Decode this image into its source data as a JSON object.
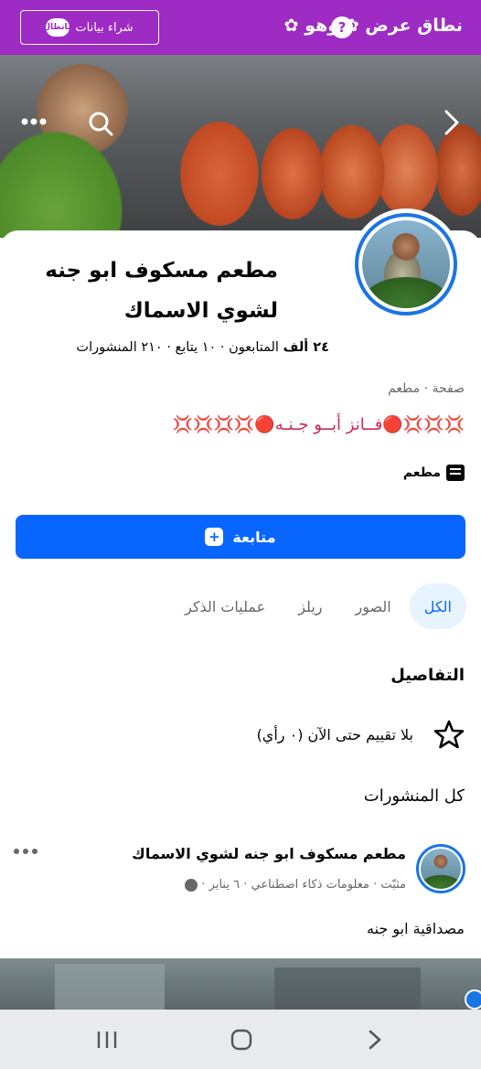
{
  "topbar": {
    "brand": "نطاق عرض ✿ وهو ✿",
    "help_glyph": "?",
    "buy_label": "شراء بيانات",
    "buy_chip": "ماتطال",
    "accent": "#9e2bc4"
  },
  "cover": {
    "icons": [
      "chevron-right-icon",
      "search-icon",
      "more-icon"
    ]
  },
  "profile": {
    "name": "مطعم مسكوف ابو جنه لشوي الاسماك",
    "stats": {
      "followers_count": "٢٤ ألف",
      "followers_label": "المتابعون",
      "following": "١٠ يتابع",
      "posts": "٢١٠ المنشورات",
      "sep": " · "
    },
    "category_line": "صفحة · مطعم",
    "bio": "💢💢💢🔴فــانز أبــو جـنـه🔴💢💢💢💢",
    "tag_label": "مطعم"
  },
  "follow_button": {
    "label": "متابعة",
    "color": "#0866ff"
  },
  "tabs": [
    {
      "label": "الكل",
      "active": true
    },
    {
      "label": "الصور",
      "active": false
    },
    {
      "label": "ريلز",
      "active": false
    },
    {
      "label": "عمليات الذكر",
      "active": false
    }
  ],
  "details": {
    "heading": "التفاصيل",
    "rating_text": "بلا تقييم حتى الآن (٠ رأي)"
  },
  "posts": {
    "heading": "كل المنشورات",
    "items": [
      {
        "author": "مطعم مسكوف ابو جنه لشوي الاسماك",
        "meta": "مثبّت · معلومات ذكاء اصطناعي · ٦ يناير ·",
        "text": "مصداقية ابو جنه"
      }
    ]
  },
  "navbar": {
    "icons": [
      "recent-apps-icon",
      "home-icon",
      "back-icon"
    ]
  }
}
